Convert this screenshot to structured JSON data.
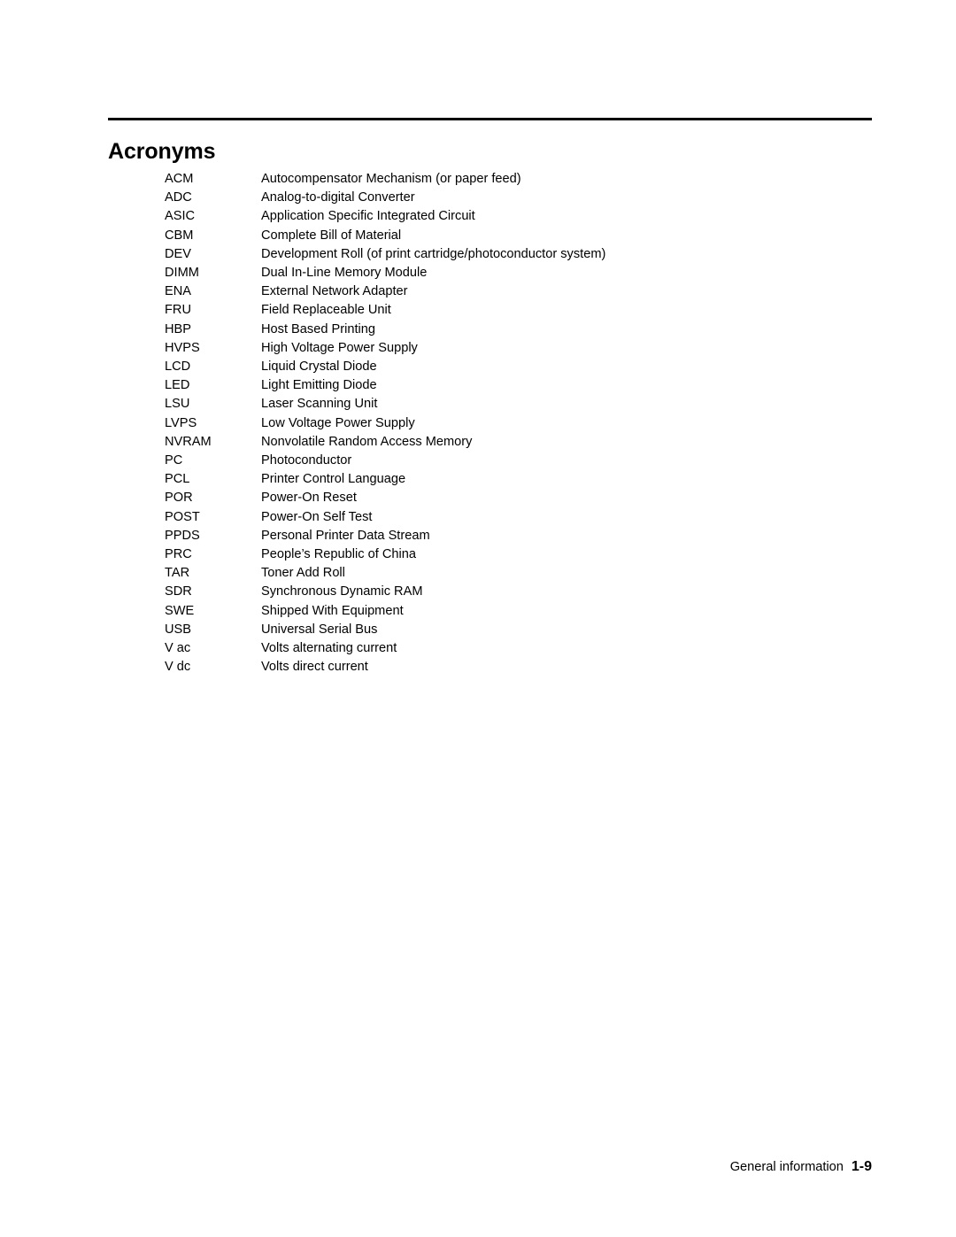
{
  "document": {
    "title": "Acronyms"
  },
  "acronyms": [
    {
      "term": "ACM",
      "definition": "Autocompensator Mechanism (or paper feed)"
    },
    {
      "term": "ADC",
      "definition": "Analog-to-digital Converter"
    },
    {
      "term": "ASIC",
      "definition": "Application Specific Integrated Circuit"
    },
    {
      "term": "CBM",
      "definition": "Complete Bill of Material"
    },
    {
      "term": "DEV",
      "definition": "Development Roll (of print cartridge/photoconductor system)"
    },
    {
      "term": "DIMM",
      "definition": "Dual In-Line Memory Module"
    },
    {
      "term": "ENA",
      "definition": "External Network Adapter"
    },
    {
      "term": "FRU",
      "definition": "Field Replaceable Unit"
    },
    {
      "term": "HBP",
      "definition": "Host Based Printing"
    },
    {
      "term": "HVPS",
      "definition": "High Voltage Power Supply"
    },
    {
      "term": "LCD",
      "definition": "Liquid Crystal Diode"
    },
    {
      "term": "LED",
      "definition": "Light Emitting Diode"
    },
    {
      "term": "LSU",
      "definition": "Laser Scanning Unit"
    },
    {
      "term": "LVPS",
      "definition": "Low Voltage Power Supply"
    },
    {
      "term": "NVRAM",
      "definition": "Nonvolatile Random Access Memory"
    },
    {
      "term": "PC",
      "definition": "Photoconductor"
    },
    {
      "term": "PCL",
      "definition": "Printer Control Language"
    },
    {
      "term": "POR",
      "definition": "Power-On Reset"
    },
    {
      "term": "POST",
      "definition": "Power-On Self Test"
    },
    {
      "term": "PPDS",
      "definition": "Personal Printer Data Stream"
    },
    {
      "term": "PRC",
      "definition": "People’s Republic of China"
    },
    {
      "term": "TAR",
      "definition": "Toner Add Roll"
    },
    {
      "term": "SDR",
      "definition": "Synchronous Dynamic RAM"
    },
    {
      "term": "SWE",
      "definition": "Shipped With Equipment"
    },
    {
      "term": "USB",
      "definition": "Universal Serial Bus"
    },
    {
      "term": "V ac",
      "definition": "Volts alternating current"
    },
    {
      "term": "V dc",
      "definition": "Volts direct current"
    }
  ],
  "footer": {
    "label": "General information",
    "page_number": "1-9"
  },
  "colors": {
    "text": "#000000",
    "rule": "#000000",
    "background": "#ffffff"
  }
}
